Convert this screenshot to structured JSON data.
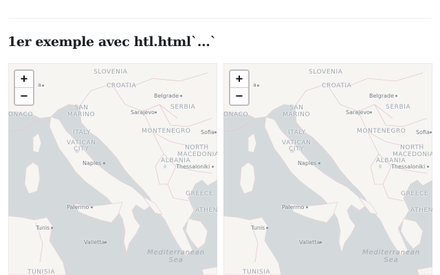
{
  "heading": "1er exemple avec htl.html`...`",
  "zoom": {
    "plus_label": "+",
    "minus_label": "−"
  },
  "map": {
    "countries": {
      "slovenia": "SLOVENIA",
      "croatia": "CROATIA",
      "serbia": "SERBIA",
      "san_marino_1": "SAN",
      "san_marino_2": "MARINO",
      "italy": "ITALY",
      "vatican_1": "VATICAN",
      "vatican_2": "CITY",
      "montenegro": "MONTENEGRO",
      "north_macedonia_1": "NORTH",
      "north_macedonia_2": "MACEDONIA",
      "albania": "ALBANIA",
      "greece": "GREECE",
      "tunisia": "TUNISIA",
      "monaco": "ONACO"
    },
    "cities": {
      "belgrade": "Belgrade",
      "sarajevo": "Sarajevo",
      "sofia": "Sofia",
      "naples": "Naples",
      "thessaloniki": "Thessaloniki",
      "palermo": "Palermo",
      "athens": "ATHENS",
      "tunis": "Tunis",
      "valletta": "Valletta",
      "ljubljana_partial": "a"
    },
    "seas": {
      "mediterranean_1": "Mediterranean",
      "mediterranean_2": "Sea"
    }
  }
}
